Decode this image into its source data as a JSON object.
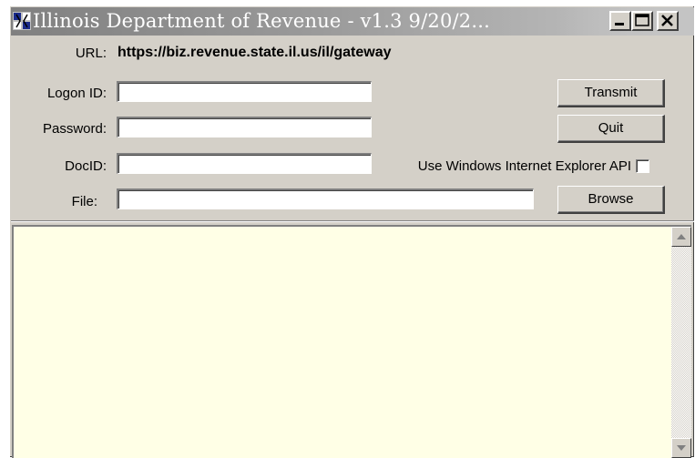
{
  "window": {
    "title": "Illinois Department of Revenue - v1.3  9/20/2..."
  },
  "icons": {
    "app": "app-icon",
    "minimize": "minimize-icon",
    "maximize": "maximize-icon",
    "close": "close-icon",
    "scroll_up": "arrow-up-icon",
    "scroll_down": "arrow-down-icon"
  },
  "form": {
    "url_label": "URL:",
    "url_value": "https://biz.revenue.state.il.us/il/gateway",
    "logon_label": "Logon ID:",
    "logon_value": "",
    "password_label": "Password:",
    "password_value": "",
    "docid_label": "DocID:",
    "docid_value": "",
    "file_label": "File:",
    "file_value": "",
    "ie_api_label": "Use Windows Internet Explorer API",
    "ie_api_checked": false
  },
  "buttons": {
    "transmit": "Transmit",
    "quit": "Quit",
    "browse": "Browse"
  },
  "output": {
    "text": ""
  },
  "colors": {
    "window_face": "#d4d0c8",
    "output_background": "#ffffe6",
    "titlebar_inactive": "#808080"
  }
}
